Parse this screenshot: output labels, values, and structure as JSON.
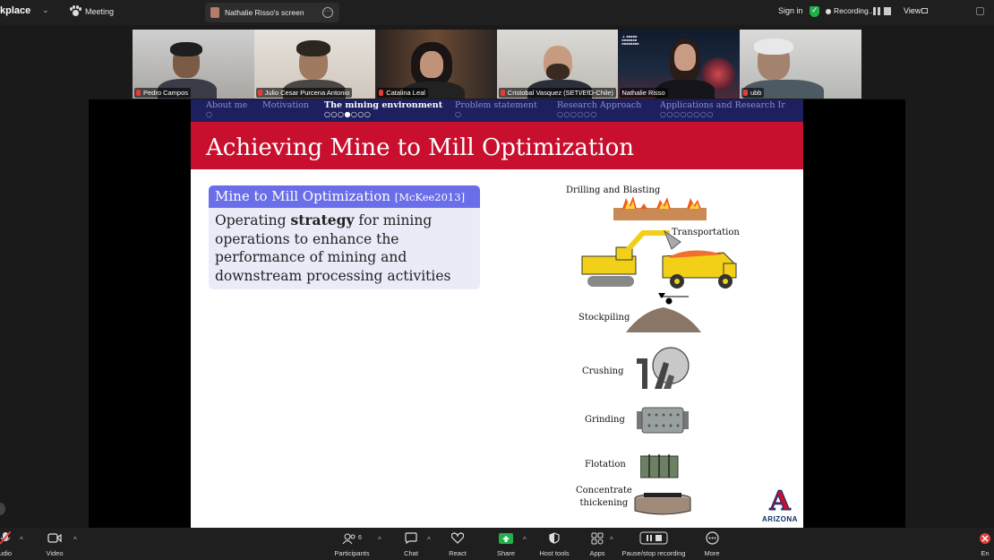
{
  "topbar": {
    "app_name": "kplace",
    "meeting_label": "Meeting",
    "tab_label": "Nathalie Risso's screen",
    "sign_in": "Sign in",
    "recording": "Recording...",
    "view": "View"
  },
  "participants": [
    {
      "name": "Pedro Campos",
      "muted": true
    },
    {
      "name": "Julio Cesar Purcena Antonio",
      "muted": true
    },
    {
      "name": "Catalina Leal",
      "muted": true
    },
    {
      "name": "Cristobal Vasquez (SETI/EfD-Chile)",
      "muted": true
    },
    {
      "name": "Nathalie Risso",
      "muted": false,
      "active_speaker": true
    },
    {
      "name": "ubb",
      "muted": true
    }
  ],
  "slide": {
    "nav_sections": [
      {
        "label": "About me",
        "dots": "○",
        "current": false
      },
      {
        "label": "Motivation",
        "dots": "",
        "current": false
      },
      {
        "label": "The mining environment",
        "dots": "○○○●○○○",
        "current": true
      },
      {
        "label": "Problem statement",
        "dots": "○",
        "current": false
      },
      {
        "label": "Research Approach",
        "dots": "○○○○○○",
        "current": false
      },
      {
        "label": "Applications and Research Ir",
        "dots": "○○○○○○○○",
        "current": false
      }
    ],
    "title": "Achieving Mine to Mill Optimization",
    "block": {
      "heading": "Mine to Mill Optimization",
      "citation": "[McKee2013]",
      "body_before": "Operating ",
      "body_bold": "strategy",
      "body_after": " for mining operations to enhance the performance of mining and downstream processing activities"
    },
    "steps": {
      "drilling": "Drilling and Blasting",
      "transport": "Transportation",
      "stockpiling": "Stockpiling",
      "crushing": "Crushing",
      "grinding": "Grinding",
      "flotation": "Flotation",
      "concentrate_1": "Concentrate",
      "concentrate_2": "thickening"
    },
    "logo": {
      "letter": "A",
      "word": "ARIZONA"
    }
  },
  "toolbar": {
    "audio": "udio",
    "video": "Video",
    "participants": "Participants",
    "participants_count": "6",
    "chat": "Chat",
    "react": "React",
    "share": "Share",
    "host_tools": "Host tools",
    "apps": "Apps",
    "record": "Pause/stop recording",
    "more": "More",
    "end": "En"
  },
  "colors": {
    "slide_title_bar": "#c8102e",
    "slide_nav_bar": "#1d1f5e",
    "block_header": "#6a6ee8",
    "active_speaker": "#2fd36e",
    "share_green": "#22b04a"
  }
}
